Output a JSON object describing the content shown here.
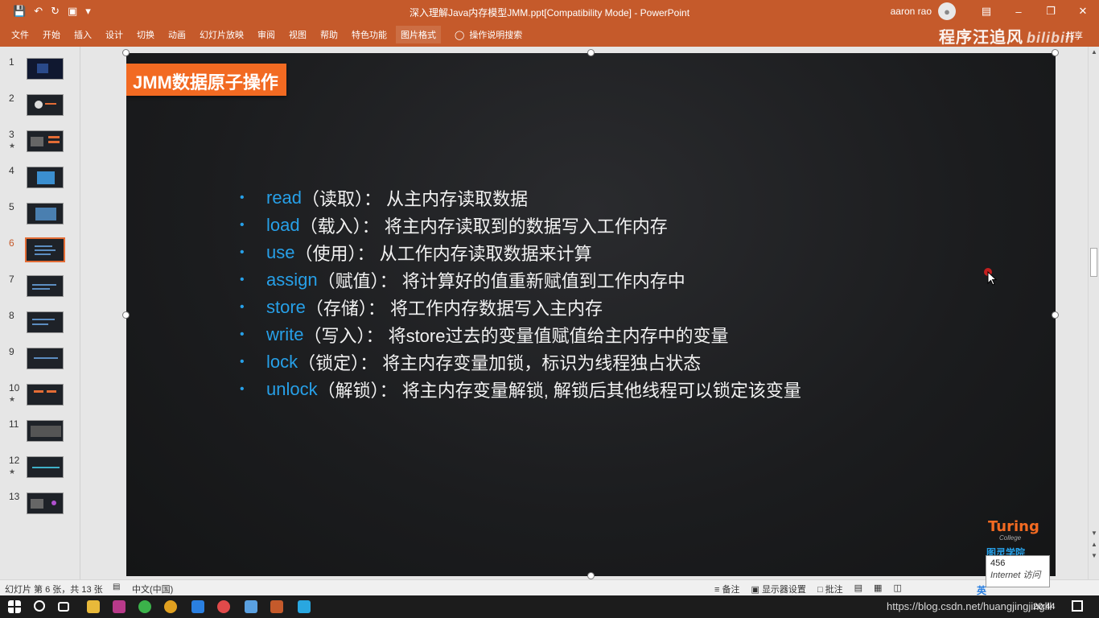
{
  "titlebar": {
    "doc_title": "深入理解Java内存模型JMM.ppt[Compatibility Mode]  -  PowerPoint",
    "user": "aaron rao",
    "qat_icons": [
      "save-icon",
      "undo-icon",
      "redo-icon",
      "slideshow-icon",
      "customize-icon"
    ]
  },
  "ribbon": {
    "tabs": [
      "文件",
      "开始",
      "插入",
      "设计",
      "切换",
      "动画",
      "幻灯片放映",
      "审阅",
      "视图",
      "帮助",
      "特色功能",
      "图片格式"
    ],
    "tell_me": "操作说明搜索",
    "share": "共享",
    "watermark": "程序汪追风",
    "watermark_logo": "bilibili"
  },
  "thumbnails": [
    {
      "num": "1",
      "star": ""
    },
    {
      "num": "2",
      "star": ""
    },
    {
      "num": "3",
      "star": "★"
    },
    {
      "num": "4",
      "star": ""
    },
    {
      "num": "5",
      "star": ""
    },
    {
      "num": "6",
      "star": "",
      "current": true
    },
    {
      "num": "7",
      "star": ""
    },
    {
      "num": "8",
      "star": ""
    },
    {
      "num": "9",
      "star": ""
    },
    {
      "num": "10",
      "star": "★"
    },
    {
      "num": "11",
      "star": ""
    },
    {
      "num": "12",
      "star": "★"
    },
    {
      "num": "13",
      "star": ""
    }
  ],
  "slide": {
    "title": "JMM数据原子操作",
    "bullets": [
      {
        "kw": "read",
        "rest": "（读取）： 从主内存读取数据"
      },
      {
        "kw": "load",
        "rest": "（载入）： 将主内存读取到的数据写入工作内存"
      },
      {
        "kw": "use",
        "rest": "（使用）： 从工作内存读取数据来计算"
      },
      {
        "kw": "assign",
        "rest": "（赋值）： 将计算好的值重新赋值到工作内存中"
      },
      {
        "kw": "store",
        "rest": "（存储）： 将工作内存数据写入主内存"
      },
      {
        "kw": "write",
        "rest": "（写入）： 将store过去的变量值赋值给主内存中的变量"
      },
      {
        "kw": "lock",
        "rest": "（锁定）： 将主内存变量加锁，标识为线程独占状态"
      },
      {
        "kw": "unlock",
        "rest": "（解锁）： 将主内存变量解锁, 解锁后其他线程可以锁定该变量"
      }
    ],
    "logo": {
      "brand": "Turing",
      "sub": "College",
      "cn": "图灵学院"
    }
  },
  "statusbar": {
    "slide_info": "幻灯片 第 6 张，共 13 张",
    "language": "中文(中国)",
    "notes": "备注",
    "display_settings": "显示器设置",
    "comments": "批注"
  },
  "visits": {
    "count": "456",
    "label": "Internet 访问"
  },
  "taskbar": {
    "url": "https://blog.csdn.net/huangjingjinglll",
    "time": "20:44",
    "ime": "英"
  },
  "colors": {
    "accent": "#c55a2b",
    "slide_title_bg": "#f26a22",
    "keyword": "#27a0e8"
  }
}
